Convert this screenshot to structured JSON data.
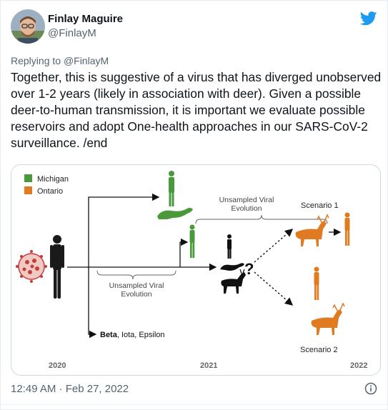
{
  "author": {
    "name": "Finlay Maguire",
    "handle": "@FinlayM"
  },
  "reply": {
    "prefix": "Replying to ",
    "to": "@FinlayM"
  },
  "tweet": {
    "text": "Together, this is suggestive of a virus that has diverged unobserved over 1-2 years (likely in association with deer). Given a possible deer-to-human transmission, it is important we evaluate possible reservoirs and adopt One-health approaches in our SARS-CoV-2 surveillance. /end"
  },
  "figure": {
    "legend": [
      "Michigan",
      "Ontario"
    ],
    "colors": {
      "michigan": "#4a9a3c",
      "ontario": "#e07b22"
    },
    "label_unsampled_top": [
      "Unsampled Viral",
      "Evolution"
    ],
    "label_unsampled_bottom": [
      "Unsampled Viral",
      "Evolution"
    ],
    "scenario1": "Scenario 1",
    "scenario2": "Scenario 2",
    "question_mark": "?",
    "variants_bold": "Beta",
    "variants_rest": ", Iota, Epsilon",
    "years": [
      "2020",
      "2021",
      "2022"
    ]
  },
  "footer": {
    "timestamp": "12:49 AM · Feb 27, 2022"
  },
  "icons": [
    "twitter-bird-icon",
    "info-icon",
    "avatar"
  ]
}
